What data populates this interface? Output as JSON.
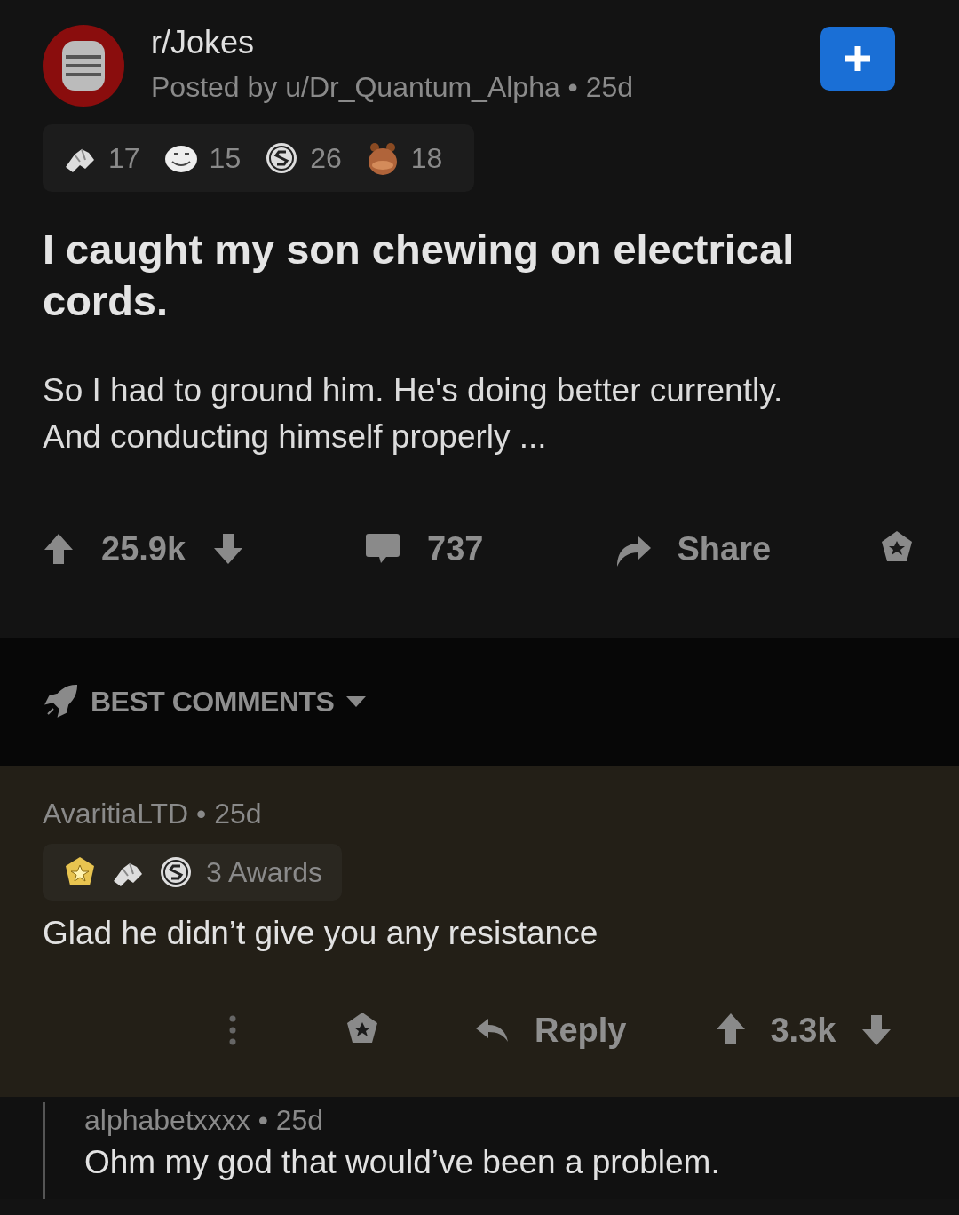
{
  "post": {
    "subreddit": "r/Jokes",
    "meta": "Posted by u/Dr_Quantum_Alpha • 25d",
    "awards": [
      {
        "kind": "handshake",
        "count": "17"
      },
      {
        "kind": "face",
        "count": "15"
      },
      {
        "kind": "coin",
        "count": "26"
      },
      {
        "kind": "bear",
        "count": "18"
      }
    ],
    "title": "I caught my son chewing on electrical cords.",
    "body": [
      "So I had to ground him. He's doing better currently.",
      "And conducting himself properly ..."
    ],
    "score": "25.9k",
    "comments": "737",
    "share": "Share"
  },
  "sort": {
    "label": "BEST COMMENTS"
  },
  "comment": {
    "author": "AvaritiaLTD • 25d",
    "highlighted": true,
    "awards": [
      {
        "kind": "badge"
      },
      {
        "kind": "handshake"
      },
      {
        "kind": "coin"
      }
    ],
    "awards_label": "3 Awards",
    "text": "Glad he didn’t give you any resistance",
    "reply": "Reply",
    "score": "3.3k"
  },
  "reply": {
    "author": "alphabetxxxx • 25d",
    "text": "Ohm my god that would’ve been a problem."
  }
}
